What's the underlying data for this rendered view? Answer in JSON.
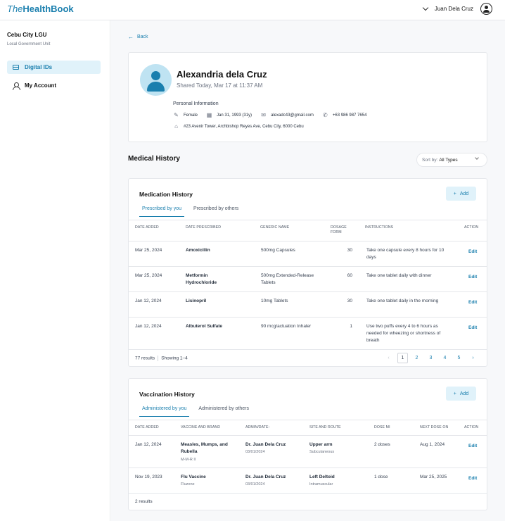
{
  "header": {
    "logo_the": "The",
    "logo_name": "HealthBook",
    "user_name": "Juan Dela Cruz"
  },
  "sidebar": {
    "org": "Cebu City LGU",
    "org_sub": "Local Government Unit",
    "items": [
      {
        "label": "Digital IDs",
        "icon": "id-card-icon"
      },
      {
        "label": "My Account",
        "icon": "user-icon"
      }
    ]
  },
  "main": {
    "back": "Back",
    "profile": {
      "name": "Alexandria dela Cruz",
      "shared": "Shared Today, Mar 17 at 11:37 AM",
      "section": "Personal Information",
      "sex": "Female",
      "dob": "Jan 31, 1993 (31y)",
      "email": "alexadc43@gmail.com",
      "phone": "+63 986 987 7654",
      "address": "#23 Avenir Tower, Archbishop Reyes Ave, Cebu City, 6000 Cebu"
    },
    "section_title": "Medical History",
    "sort_label": "Sort by:",
    "sort_value": "All Types",
    "medication": {
      "title": "Medication History",
      "add": "Add",
      "tabs": [
        "Prescribed by you",
        "Prescribed by others"
      ],
      "columns": [
        "Date Added",
        "Date Prescribed",
        "Generic Name",
        "Dosage Form",
        "Instructions",
        "Action"
      ],
      "rows": [
        {
          "added": "Mar 25, 2024",
          "drug": "Amoxicillin",
          "generic": "500mg Capsules",
          "qty": "30",
          "instructions": "Take one capsule every 8 hours for 10 days",
          "action": "Edit"
        },
        {
          "added": "Mar 25, 2024",
          "drug": "Metformin Hydrochloride",
          "generic": "500mg Extended-Release Tablets",
          "qty": "60",
          "instructions": "Take one tablet daily with dinner",
          "action": "Edit"
        },
        {
          "added": "Jan 12, 2024",
          "drug": "Lisinopril",
          "generic": "10mg Tablets",
          "qty": "30",
          "instructions": "Take one tablet daily in the morning",
          "action": "Edit"
        },
        {
          "added": "Jan 12, 2024",
          "drug": "Albuterol Sulfate",
          "generic": "90 mcg/actuation Inhaler",
          "qty": "1",
          "instructions": "Use two puffs every 4 to 6 hours as needed for wheezing or shortness of breath",
          "action": "Edit"
        }
      ],
      "results": "77 results",
      "showing": "Showing 1–4",
      "pages": [
        "1",
        "2",
        "3",
        "4",
        "5"
      ]
    },
    "vaccination": {
      "title": "Vaccination History",
      "add": "Add",
      "tabs": [
        "Administered by you",
        "Administered by others"
      ],
      "columns": [
        "Date Added",
        "Vaccine and Brand",
        "Admin/Date:",
        "Site and Route",
        "Dose MI",
        "Next Dose On",
        "Action"
      ],
      "rows": [
        {
          "added": "Jan 12, 2024",
          "vaccine": "Measles, Mumps, and Rubella",
          "brand": "M-M-R II",
          "admin": "Dr. Juan Dela Cruz",
          "admin_date": "03/01/2024",
          "site": "Upper arm",
          "route": "Subcutaneous",
          "dose": "2 doses",
          "next": "Aug 1, 2024",
          "action": "Edit"
        },
        {
          "added": "Nov 19, 2023",
          "vaccine": "Flu Vaccine",
          "brand": "Fluzone",
          "admin": "Dr. Juan Dela Cruz",
          "admin_date": "03/01/2024",
          "site": "Left Deltoid",
          "route": "Intramuscular",
          "dose": "1 dose",
          "next": "Mar 25, 2025",
          "action": "Edit"
        }
      ],
      "results": "2 results"
    }
  }
}
